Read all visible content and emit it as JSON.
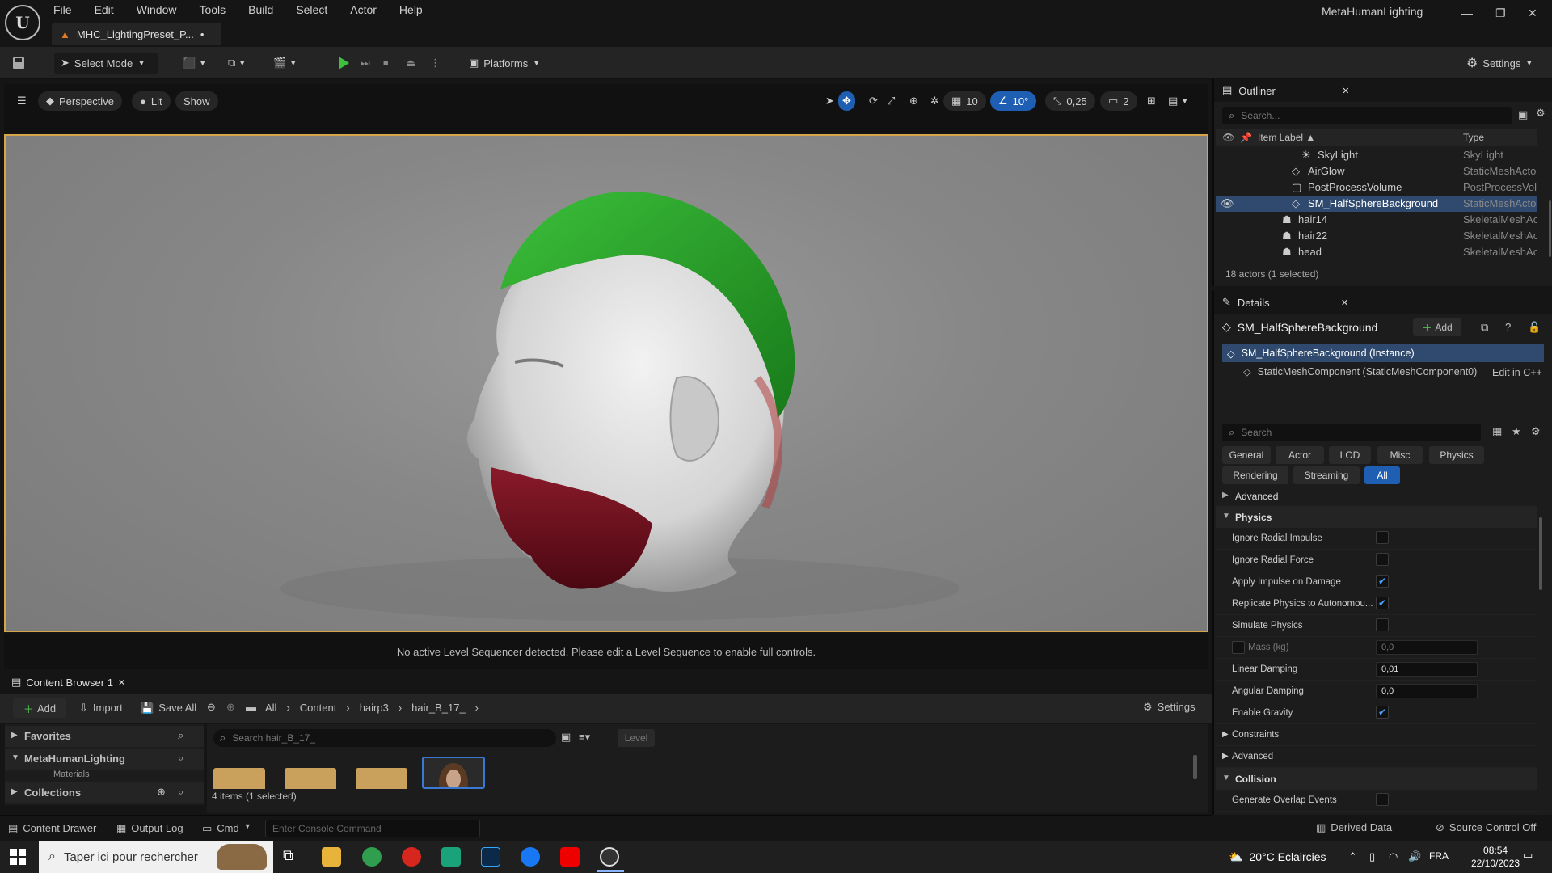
{
  "app": {
    "logo": "U",
    "title": "MetaHumanLighting",
    "tab_label": "MHC_LightingPreset_P...",
    "tab_modified": "•"
  },
  "menu": [
    "File",
    "Edit",
    "Window",
    "Tools",
    "Build",
    "Select",
    "Actor",
    "Help"
  ],
  "window_controls": {
    "minimize": "—",
    "restore": "❐",
    "close": "✕"
  },
  "toolbar": {
    "select_mode": "Select Mode",
    "platforms": "Platforms",
    "settings": "Settings"
  },
  "viewport": {
    "menu_icon": "hamburger-icon",
    "perspective": "Perspective",
    "lit": "Lit",
    "show": "Show",
    "grid_size": "10",
    "rotation_snap": "10°",
    "scale_snap": "0,25",
    "camera_speed": "2",
    "sequencer_message": "No active Level Sequencer detected. Please edit a Level Sequence to enable full controls."
  },
  "outliner": {
    "title": "Outliner",
    "search_placeholder": "Search...",
    "col_label": "Item Label ▲",
    "col_type": "Type",
    "rows": [
      {
        "label": "SkyLight",
        "type": "SkyLight"
      },
      {
        "label": "AirGlow",
        "type": "StaticMeshActo"
      },
      {
        "label": "PostProcessVolume",
        "type": "PostProcessVol"
      },
      {
        "label": "SM_HalfSphereBackground",
        "type": "StaticMeshActo"
      },
      {
        "label": "hair14",
        "type": "SkeletalMeshAc"
      },
      {
        "label": "hair22",
        "type": "SkeletalMeshAc"
      },
      {
        "label": "head",
        "type": "SkeletalMeshAc"
      }
    ],
    "footer": "18 actors (1 selected)"
  },
  "details": {
    "title": "Details",
    "object_name": "SM_HalfSphereBackground",
    "add_label": "Add",
    "instance_label": "SM_HalfSphereBackground (Instance)",
    "component_label": "StaticMeshComponent (StaticMeshComponent0)",
    "edit_cpp": "Edit in C++",
    "search_placeholder": "Search",
    "filters": [
      "General",
      "Actor",
      "LOD",
      "Misc",
      "Physics",
      "Rendering",
      "Streaming",
      "All"
    ],
    "advanced_top": "Advanced",
    "physics_section": "Physics",
    "props": [
      {
        "name": "Ignore Radial Impulse",
        "kind": "check",
        "checked": false
      },
      {
        "name": "Ignore Radial Force",
        "kind": "check",
        "checked": false
      },
      {
        "name": "Apply Impulse on Damage",
        "kind": "check",
        "checked": true
      },
      {
        "name": "Replicate Physics to Autonomou...",
        "kind": "check",
        "checked": true
      },
      {
        "name": "Simulate Physics",
        "kind": "check",
        "checked": false
      },
      {
        "name": "Mass (kg)",
        "kind": "num",
        "value": "0,0"
      },
      {
        "name": "Linear Damping",
        "kind": "num",
        "value": "0,01"
      },
      {
        "name": "Angular Damping",
        "kind": "num",
        "value": "0,0"
      },
      {
        "name": "Enable Gravity",
        "kind": "check",
        "checked": true
      }
    ],
    "constraints": "Constraints",
    "advanced_bottom": "Advanced",
    "collision_section": "Collision",
    "collision_prop": "Generate Overlap Events"
  },
  "content_browser": {
    "tab": "Content Browser 1",
    "add": "Add",
    "import": "Import",
    "save_all": "Save All",
    "breadcrumb": [
      "All",
      "Content",
      "hairp3",
      "hair_B_17_"
    ],
    "settings": "Settings",
    "favorites": "Favorites",
    "project": "MetaHumanLighting",
    "materials": "Materials",
    "collections": "Collections",
    "search_placeholder": "Search hair_B_17_",
    "level_filter": "Level",
    "items_count": "4 items (1 selected)"
  },
  "statusbar": {
    "content_drawer": "Content Drawer",
    "output_log": "Output Log",
    "cmd": "Cmd",
    "console_placeholder": "Enter Console Command",
    "derived_data": "Derived Data",
    "source_control": "Source Control Off"
  },
  "taskbar": {
    "search_placeholder": "Taper ici pour rechercher",
    "weather": "20°C  Eclaircies",
    "lang": "FRA",
    "time": "08:54",
    "date": "22/10/2023"
  },
  "colors": {
    "accent": "#1f5fb3",
    "viewport_border": "#d6a54a",
    "hair": "#2aa52a",
    "beard": "#7a1020"
  }
}
